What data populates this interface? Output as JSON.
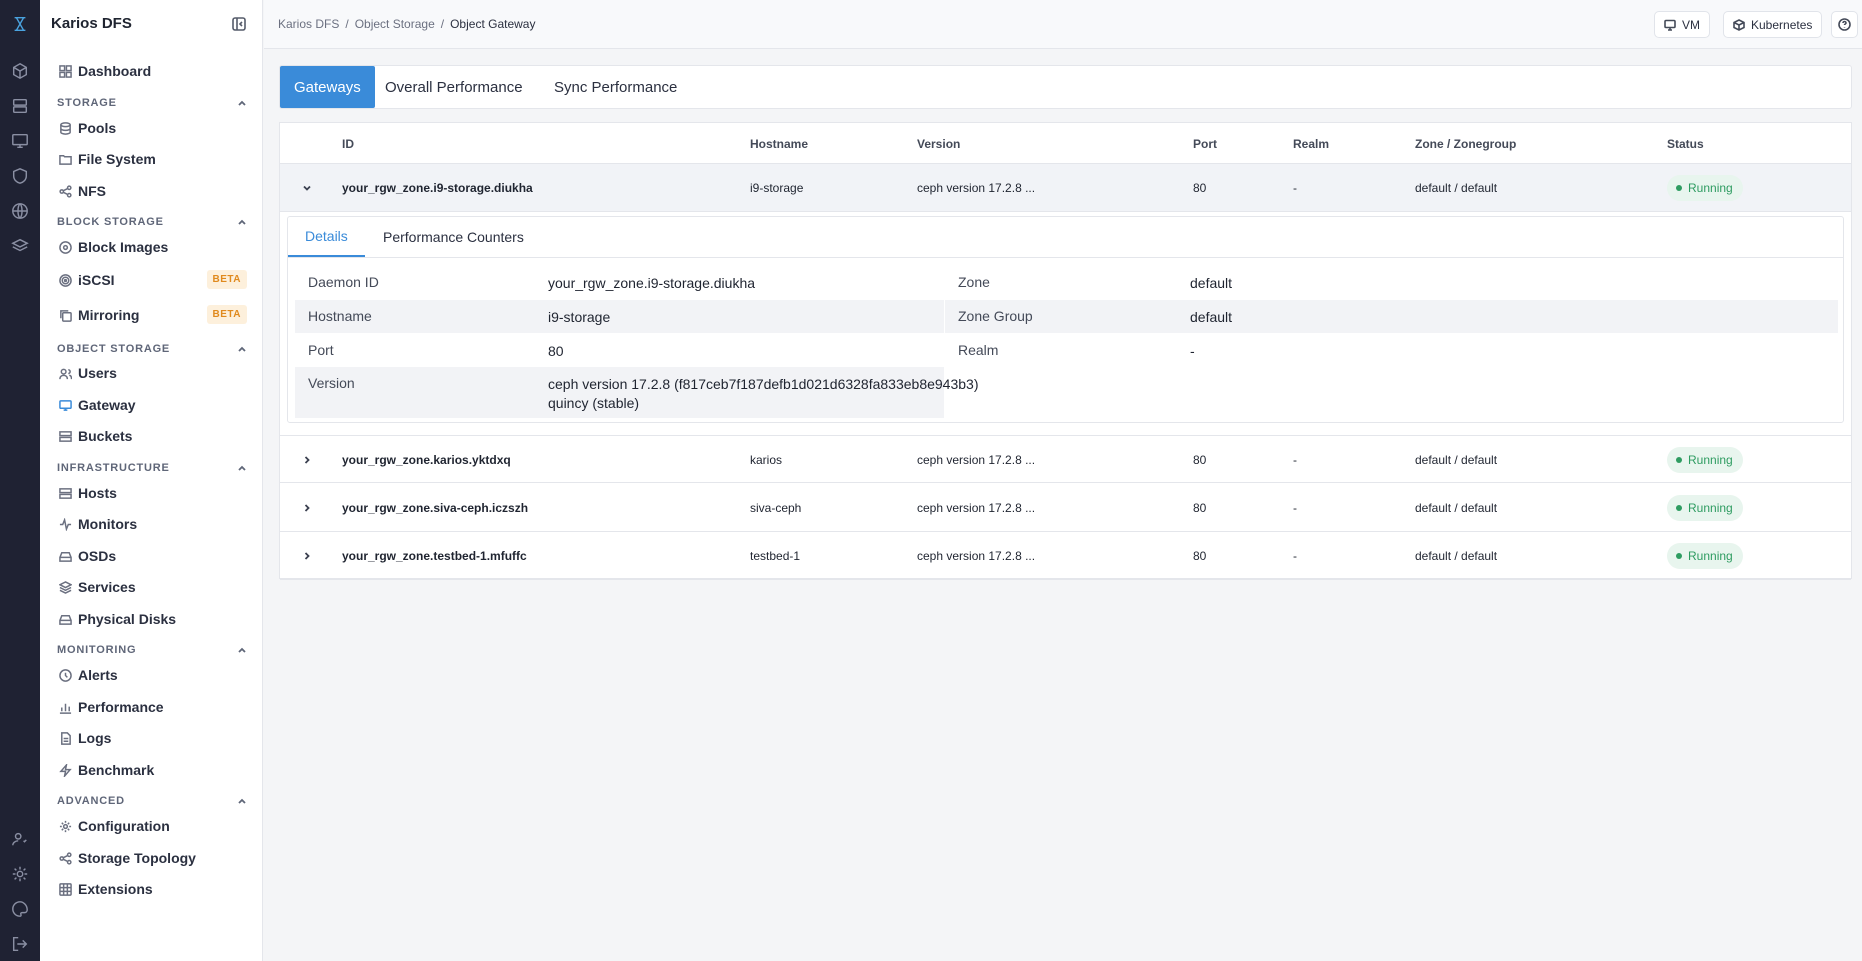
{
  "app": {
    "name": "Karios DFS"
  },
  "rail": [
    "logo-icon",
    "cube-icon",
    "server-icon",
    "monitor-icon",
    "shield-icon",
    "globe-icon",
    "layers-icon",
    "user-settings-icon",
    "gear-icon",
    "palette-icon",
    "logout-icon"
  ],
  "sidebar": {
    "dashboard": "Dashboard",
    "storage": {
      "title": "STORAGE",
      "items": [
        "Pools",
        "File System",
        "NFS"
      ]
    },
    "block": {
      "title": "BLOCK STORAGE",
      "items": [
        "Block Images",
        "iSCSI",
        "Mirroring"
      ],
      "beta": "BETA"
    },
    "object": {
      "title": "OBJECT STORAGE",
      "items": [
        "Users",
        "Gateway",
        "Buckets"
      ]
    },
    "infra": {
      "title": "INFRASTRUCTURE",
      "items": [
        "Hosts",
        "Monitors",
        "OSDs",
        "Services",
        "Physical Disks"
      ]
    },
    "monitoring": {
      "title": "MONITORING",
      "items": [
        "Alerts",
        "Performance",
        "Logs",
        "Benchmark"
      ]
    },
    "advanced": {
      "title": "ADVANCED",
      "items": [
        "Configuration",
        "Storage Topology",
        "Extensions"
      ]
    }
  },
  "breadcrumb": [
    "Karios DFS",
    "/",
    "Object Storage",
    "/",
    "Object Gateway"
  ],
  "topbar": {
    "vm": "VM",
    "kubernetes": "Kubernetes"
  },
  "tabs": [
    "Gateways",
    "Overall Performance",
    "Sync Performance"
  ],
  "table": {
    "headers": [
      "ID",
      "Hostname",
      "Version",
      "Port",
      "Realm",
      "Zone / Zonegroup",
      "Status"
    ],
    "rows": [
      {
        "id": "your_rgw_zone.i9-storage.diukha",
        "hostname": "i9-storage",
        "version": "ceph version 17.2.8 ...",
        "port": "80",
        "realm": "-",
        "zone": "default / default",
        "status": "Running"
      },
      {
        "id": "your_rgw_zone.karios.yktdxq",
        "hostname": "karios",
        "version": "ceph version 17.2.8 ...",
        "port": "80",
        "realm": "-",
        "zone": "default / default",
        "status": "Running"
      },
      {
        "id": "your_rgw_zone.siva-ceph.iczszh",
        "hostname": "siva-ceph",
        "version": "ceph version 17.2.8 ...",
        "port": "80",
        "realm": "-",
        "zone": "default / default",
        "status": "Running"
      },
      {
        "id": "your_rgw_zone.testbed-1.mfuffc",
        "hostname": "testbed-1",
        "version": "ceph version 17.2.8 ...",
        "port": "80",
        "realm": "-",
        "zone": "default / default",
        "status": "Running"
      }
    ]
  },
  "details": {
    "tabs": [
      "Details",
      "Performance Counters"
    ],
    "left": [
      {
        "k": "Daemon ID",
        "v": "your_rgw_zone.i9-storage.diukha"
      },
      {
        "k": "Hostname",
        "v": "i9-storage"
      },
      {
        "k": "Port",
        "v": "80"
      },
      {
        "k": "Version",
        "v": "ceph version 17.2.8 (f817ceb7f187defb1d021d6328fa833eb8e943b3) quincy (stable)"
      }
    ],
    "right": [
      {
        "k": "Zone",
        "v": "default"
      },
      {
        "k": "Zone Group",
        "v": "default"
      },
      {
        "k": "Realm",
        "v": "-"
      }
    ]
  },
  "colors": {
    "accent": "#3a8bd9",
    "rail": "#1f2233",
    "running": "#2e9c61",
    "beta": "#e08a1e"
  }
}
